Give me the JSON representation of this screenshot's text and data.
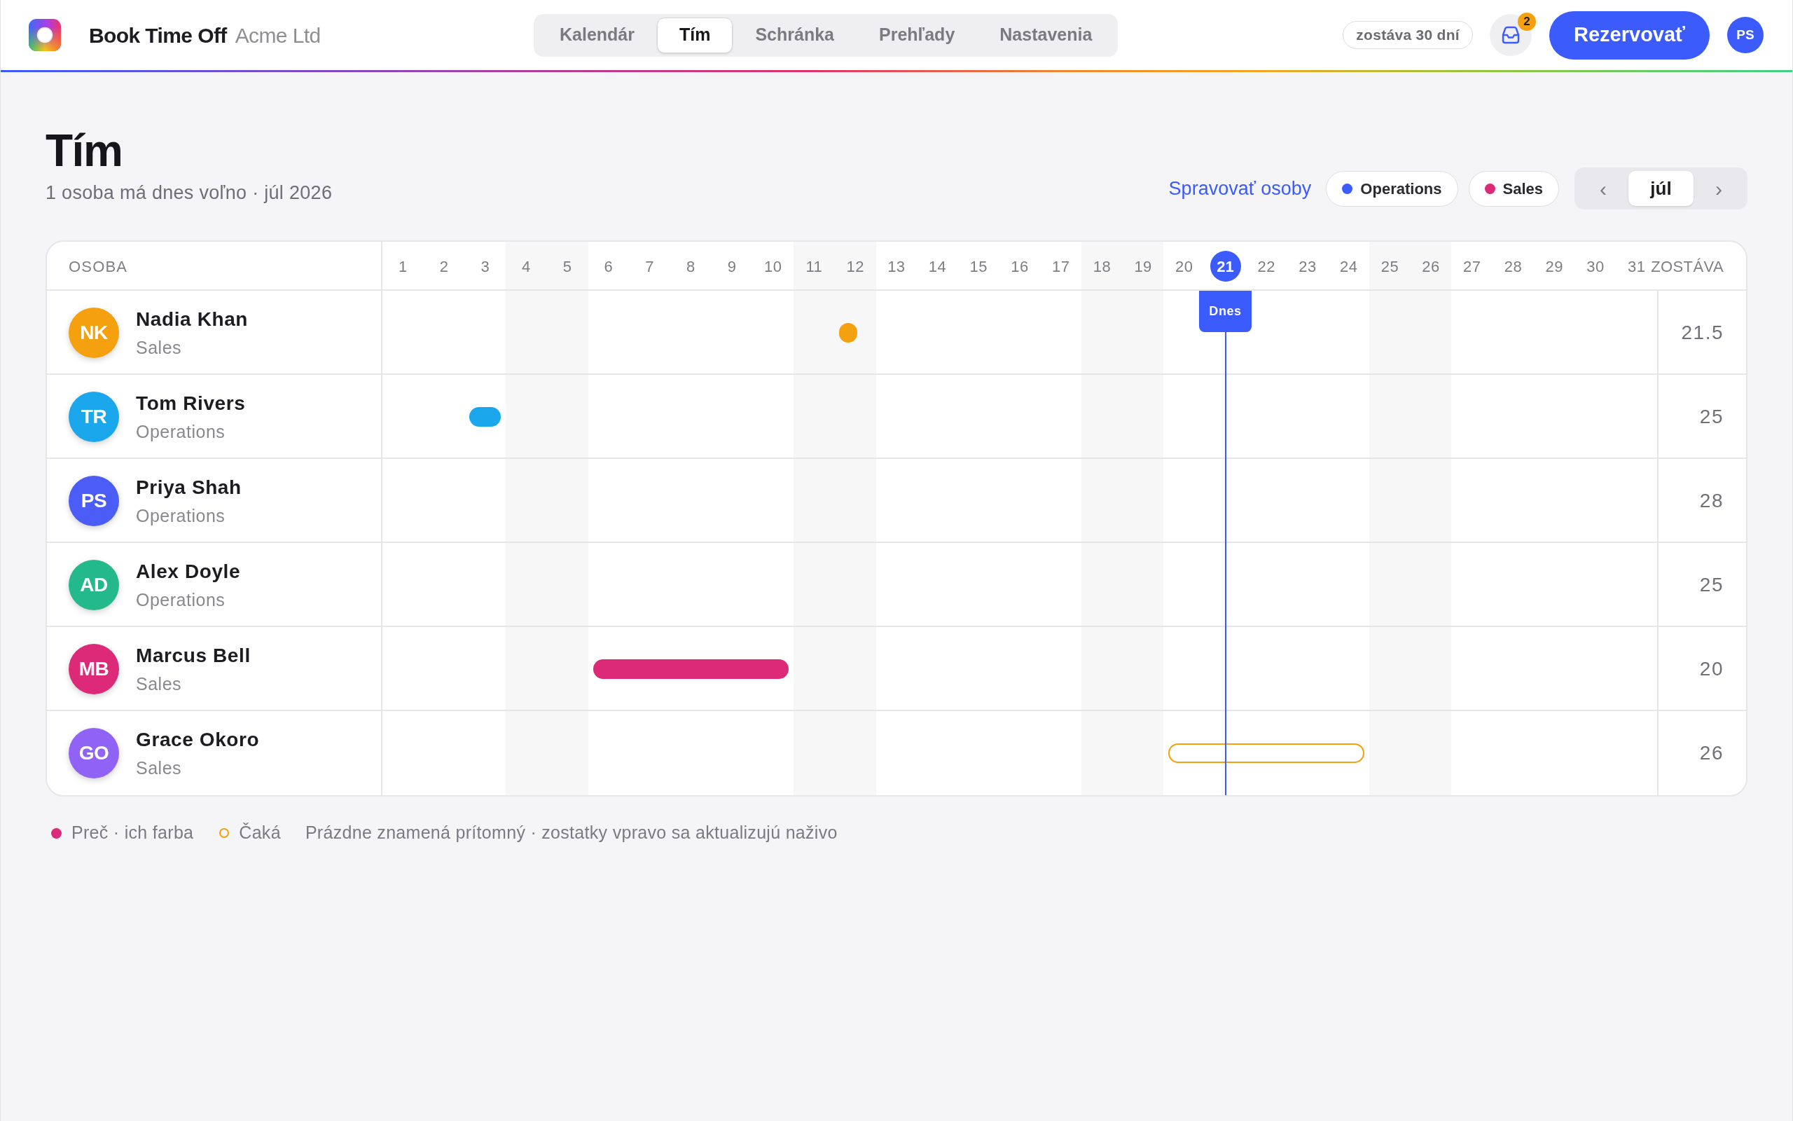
{
  "app": {
    "name": "Book Time Off",
    "org": "Acme Ltd"
  },
  "tabs": [
    {
      "label": "Kalendár",
      "selected": false
    },
    {
      "label": "Tím",
      "selected": true
    },
    {
      "label": "Schránka",
      "selected": false
    },
    {
      "label": "Prehľady",
      "selected": false
    },
    {
      "label": "Nastavenia",
      "selected": false
    }
  ],
  "balance_pill": "zostáva 30 dní",
  "inbox": {
    "badge": "2"
  },
  "book_button": "Rezervovať",
  "user": {
    "initials": "PS"
  },
  "page": {
    "title": "Tím",
    "subtitle": "1 osoba má dnes voľno · júl 2026",
    "manage_link": "Spravovať osoby",
    "team_filters": [
      {
        "label": "Operations",
        "color": "#3b5bfd"
      },
      {
        "label": "Sales",
        "color": "#dc2a78"
      }
    ],
    "month_nav": {
      "prev": "‹",
      "month": "júl",
      "next": "›"
    }
  },
  "table": {
    "person_header": "OSOBA",
    "balance_header": "ZOSTÁVA",
    "today_label": "Dnes",
    "days": [
      {
        "label": "1",
        "weekend": false,
        "today": false
      },
      {
        "label": "2",
        "weekend": false,
        "today": false
      },
      {
        "label": "3",
        "weekend": false,
        "today": false
      },
      {
        "label": "4",
        "weekend": true,
        "today": false
      },
      {
        "label": "5",
        "weekend": true,
        "today": false
      },
      {
        "label": "6",
        "weekend": false,
        "today": false
      },
      {
        "label": "7",
        "weekend": false,
        "today": false
      },
      {
        "label": "8",
        "weekend": false,
        "today": false
      },
      {
        "label": "9",
        "weekend": false,
        "today": false
      },
      {
        "label": "10",
        "weekend": false,
        "today": false
      },
      {
        "label": "11",
        "weekend": true,
        "today": false
      },
      {
        "label": "12",
        "weekend": true,
        "today": false
      },
      {
        "label": "13",
        "weekend": false,
        "today": false
      },
      {
        "label": "14",
        "weekend": false,
        "today": false
      },
      {
        "label": "15",
        "weekend": false,
        "today": false
      },
      {
        "label": "16",
        "weekend": false,
        "today": false
      },
      {
        "label": "17",
        "weekend": false,
        "today": false
      },
      {
        "label": "18",
        "weekend": true,
        "today": false
      },
      {
        "label": "19",
        "weekend": true,
        "today": false
      },
      {
        "label": "20",
        "weekend": false,
        "today": false
      },
      {
        "label": "21",
        "weekend": false,
        "today": true
      },
      {
        "label": "22",
        "weekend": false,
        "today": false
      },
      {
        "label": "23",
        "weekend": false,
        "today": false
      },
      {
        "label": "24",
        "weekend": false,
        "today": false
      },
      {
        "label": "25",
        "weekend": true,
        "today": false
      },
      {
        "label": "26",
        "weekend": true,
        "today": false
      },
      {
        "label": "27",
        "weekend": false,
        "today": false
      },
      {
        "label": "28",
        "weekend": false,
        "today": false
      },
      {
        "label": "29",
        "weekend": false,
        "today": false
      },
      {
        "label": "30",
        "weekend": false,
        "today": false
      },
      {
        "label": "31",
        "weekend": false,
        "today": false
      }
    ],
    "rows": [
      {
        "initials": "NK",
        "name": "Nadia Khan",
        "team": "Sales",
        "color": "#f5a00f",
        "balance": "21.5",
        "cells": [
          {
            "kind": "free"
          },
          {
            "kind": "free"
          },
          {
            "kind": "free"
          },
          {
            "kind": "free"
          },
          {
            "kind": "free"
          },
          {
            "kind": "free"
          },
          {
            "kind": "free"
          },
          {
            "kind": "free"
          },
          {
            "kind": "free"
          },
          {
            "kind": "free"
          },
          {
            "kind": "free"
          },
          {
            "kind": "half"
          },
          {
            "kind": "free"
          },
          {
            "kind": "free"
          },
          {
            "kind": "free"
          },
          {
            "kind": "free"
          },
          {
            "kind": "free"
          },
          {
            "kind": "free"
          },
          {
            "kind": "free"
          },
          {
            "kind": "free"
          },
          {
            "kind": "free"
          },
          {
            "kind": "free"
          },
          {
            "kind": "free"
          },
          {
            "kind": "free"
          },
          {
            "kind": "free"
          },
          {
            "kind": "free"
          },
          {
            "kind": "free"
          },
          {
            "kind": "free"
          },
          {
            "kind": "free"
          },
          {
            "kind": "free"
          },
          {
            "kind": "free"
          }
        ]
      },
      {
        "initials": "TR",
        "name": "Tom Rivers",
        "team": "Operations",
        "color": "#1aa7ec",
        "balance": "25",
        "cells": [
          {
            "kind": "free"
          },
          {
            "kind": "free"
          },
          {
            "kind": "full"
          },
          {
            "kind": "free"
          },
          {
            "kind": "free"
          },
          {
            "kind": "free"
          },
          {
            "kind": "free"
          },
          {
            "kind": "free"
          },
          {
            "kind": "free"
          },
          {
            "kind": "free"
          },
          {
            "kind": "free"
          },
          {
            "kind": "free"
          },
          {
            "kind": "free"
          },
          {
            "kind": "free"
          },
          {
            "kind": "free"
          },
          {
            "kind": "free"
          },
          {
            "kind": "free"
          },
          {
            "kind": "free"
          },
          {
            "kind": "free"
          },
          {
            "kind": "free"
          },
          {
            "kind": "free"
          },
          {
            "kind": "free"
          },
          {
            "kind": "free"
          },
          {
            "kind": "free"
          },
          {
            "kind": "free"
          },
          {
            "kind": "free"
          },
          {
            "kind": "free"
          },
          {
            "kind": "free"
          },
          {
            "kind": "free"
          },
          {
            "kind": "free"
          },
          {
            "kind": "free"
          }
        ]
      },
      {
        "initials": "PS",
        "name": "Priya Shah",
        "team": "Operations",
        "color": "#4b5cf7",
        "balance": "28",
        "cells": [
          {
            "kind": "free"
          },
          {
            "kind": "free"
          },
          {
            "kind": "free"
          },
          {
            "kind": "free"
          },
          {
            "kind": "free"
          },
          {
            "kind": "free"
          },
          {
            "kind": "free"
          },
          {
            "kind": "free"
          },
          {
            "kind": "free"
          },
          {
            "kind": "free"
          },
          {
            "kind": "free"
          },
          {
            "kind": "free"
          },
          {
            "kind": "free"
          },
          {
            "kind": "free"
          },
          {
            "kind": "free"
          },
          {
            "kind": "free"
          },
          {
            "kind": "free"
          },
          {
            "kind": "free"
          },
          {
            "kind": "free"
          },
          {
            "kind": "free"
          },
          {
            "kind": "free"
          },
          {
            "kind": "free"
          },
          {
            "kind": "free"
          },
          {
            "kind": "free"
          },
          {
            "kind": "free"
          },
          {
            "kind": "free"
          },
          {
            "kind": "free"
          },
          {
            "kind": "free"
          },
          {
            "kind": "free"
          },
          {
            "kind": "free"
          },
          {
            "kind": "free"
          }
        ]
      },
      {
        "initials": "AD",
        "name": "Alex Doyle",
        "team": "Operations",
        "color": "#23b98a",
        "balance": "25",
        "cells": [
          {
            "kind": "free"
          },
          {
            "kind": "free"
          },
          {
            "kind": "free"
          },
          {
            "kind": "free"
          },
          {
            "kind": "free"
          },
          {
            "kind": "free"
          },
          {
            "kind": "free"
          },
          {
            "kind": "free"
          },
          {
            "kind": "free"
          },
          {
            "kind": "free"
          },
          {
            "kind": "free"
          },
          {
            "kind": "free"
          },
          {
            "kind": "free"
          },
          {
            "kind": "free"
          },
          {
            "kind": "free"
          },
          {
            "kind": "free"
          },
          {
            "kind": "free"
          },
          {
            "kind": "free"
          },
          {
            "kind": "free"
          },
          {
            "kind": "free"
          },
          {
            "kind": "free"
          },
          {
            "kind": "free"
          },
          {
            "kind": "free"
          },
          {
            "kind": "free"
          },
          {
            "kind": "free"
          },
          {
            "kind": "free"
          },
          {
            "kind": "free"
          },
          {
            "kind": "free"
          },
          {
            "kind": "free"
          },
          {
            "kind": "free"
          },
          {
            "kind": "free"
          }
        ]
      },
      {
        "initials": "MB",
        "name": "Marcus Bell",
        "team": "Sales",
        "color": "#dc2a78",
        "balance": "20",
        "cells": [
          {
            "kind": "free"
          },
          {
            "kind": "free"
          },
          {
            "kind": "free"
          },
          {
            "kind": "free"
          },
          {
            "kind": "free"
          },
          {
            "kind": "full"
          },
          {
            "kind": "full"
          },
          {
            "kind": "full"
          },
          {
            "kind": "full"
          },
          {
            "kind": "full"
          },
          {
            "kind": "free"
          },
          {
            "kind": "free"
          },
          {
            "kind": "free"
          },
          {
            "kind": "free"
          },
          {
            "kind": "free"
          },
          {
            "kind": "free"
          },
          {
            "kind": "free"
          },
          {
            "kind": "free"
          },
          {
            "kind": "free"
          },
          {
            "kind": "free"
          },
          {
            "kind": "free"
          },
          {
            "kind": "free"
          },
          {
            "kind": "free"
          },
          {
            "kind": "free"
          },
          {
            "kind": "free"
          },
          {
            "kind": "free"
          },
          {
            "kind": "free"
          },
          {
            "kind": "free"
          },
          {
            "kind": "free"
          },
          {
            "kind": "free"
          },
          {
            "kind": "free"
          }
        ]
      },
      {
        "initials": "GO",
        "name": "Grace Okoro",
        "team": "Sales",
        "color": "#9062f5",
        "balance": "26",
        "cells": [
          {
            "kind": "free"
          },
          {
            "kind": "free"
          },
          {
            "kind": "free"
          },
          {
            "kind": "free"
          },
          {
            "kind": "free"
          },
          {
            "kind": "free"
          },
          {
            "kind": "free"
          },
          {
            "kind": "free"
          },
          {
            "kind": "free"
          },
          {
            "kind": "free"
          },
          {
            "kind": "free"
          },
          {
            "kind": "free"
          },
          {
            "kind": "free"
          },
          {
            "kind": "free"
          },
          {
            "kind": "free"
          },
          {
            "kind": "free"
          },
          {
            "kind": "free"
          },
          {
            "kind": "free"
          },
          {
            "kind": "free"
          },
          {
            "kind": "pending"
          },
          {
            "kind": "pending"
          },
          {
            "kind": "pending"
          },
          {
            "kind": "pending"
          },
          {
            "kind": "pending"
          },
          {
            "kind": "free"
          },
          {
            "kind": "free"
          },
          {
            "kind": "free"
          },
          {
            "kind": "free"
          },
          {
            "kind": "free"
          },
          {
            "kind": "free"
          },
          {
            "kind": "free"
          }
        ]
      }
    ]
  },
  "legend": {
    "items": [
      {
        "kind": "filled",
        "color": "#dc2a78",
        "label": "Preč · ich farba"
      },
      {
        "kind": "ring",
        "color": "#f5a00f",
        "label": "Čaká"
      }
    ],
    "note": "Prázdne znamená prítomný · zostatky vpravo sa aktualizujú naživo"
  }
}
